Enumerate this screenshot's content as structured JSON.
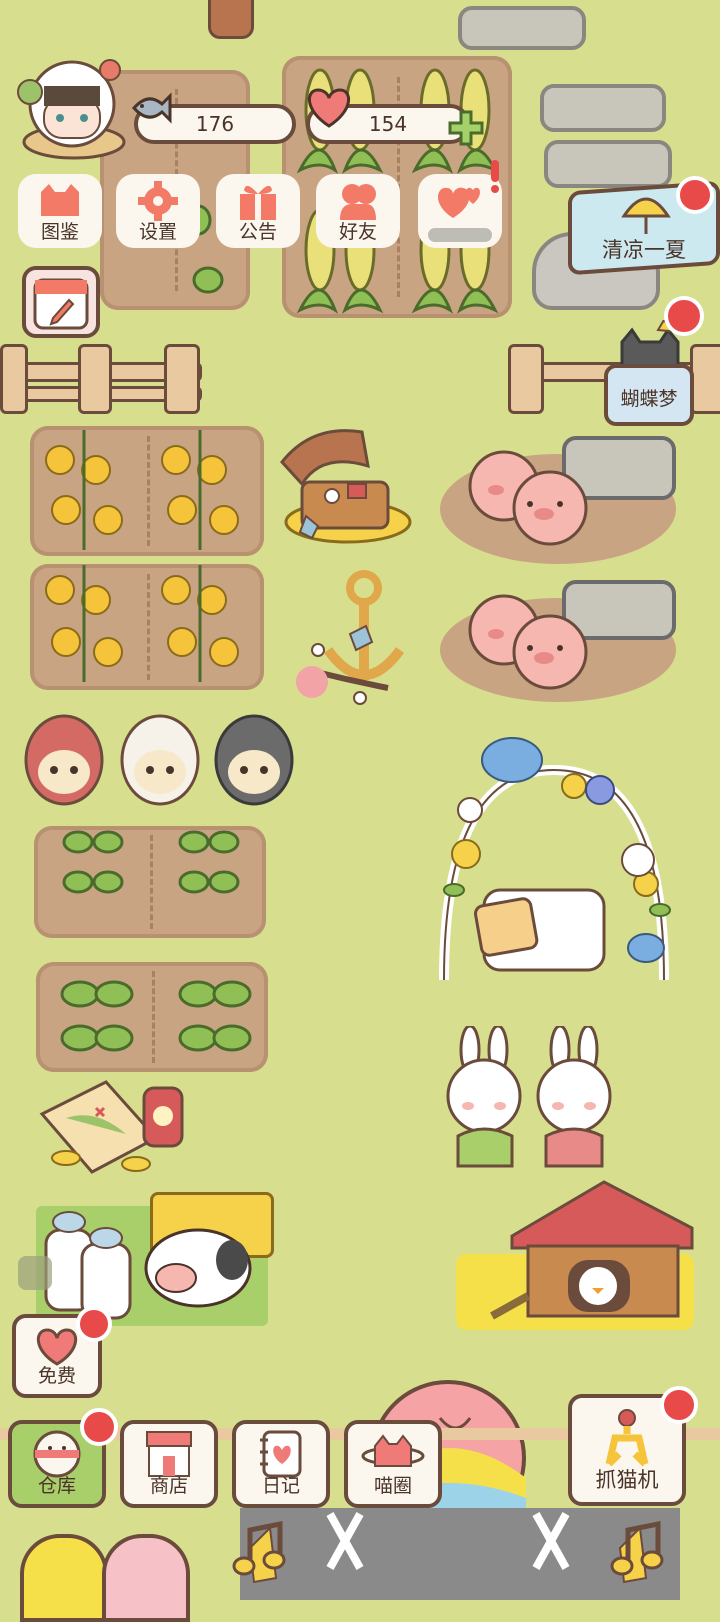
{
  "resources": {
    "fish_count": "176",
    "heart_count": "154"
  },
  "top_menu": [
    {
      "label": "图鉴",
      "icon": "cat-book-icon"
    },
    {
      "label": "设置",
      "icon": "gear-icon"
    },
    {
      "label": "公告",
      "icon": "gift-icon"
    },
    {
      "label": "好友",
      "icon": "friends-icon"
    }
  ],
  "events": {
    "summer_label": "清凉一夏",
    "butterfly_label": "蝴蝶梦"
  },
  "free_label": "免费",
  "bottom_nav": [
    {
      "label": "仓库",
      "icon": "warehouse-icon"
    },
    {
      "label": "商店",
      "icon": "shop-icon"
    },
    {
      "label": "日记",
      "icon": "diary-icon"
    },
    {
      "label": "喵圈",
      "icon": "planet-icon"
    }
  ],
  "claw_machine_label": "抓猫机",
  "colors": {
    "grass": "#d7df8f",
    "soil": "#c9a482",
    "accent_red": "#e84a4a",
    "outline": "#6b4b3b"
  }
}
